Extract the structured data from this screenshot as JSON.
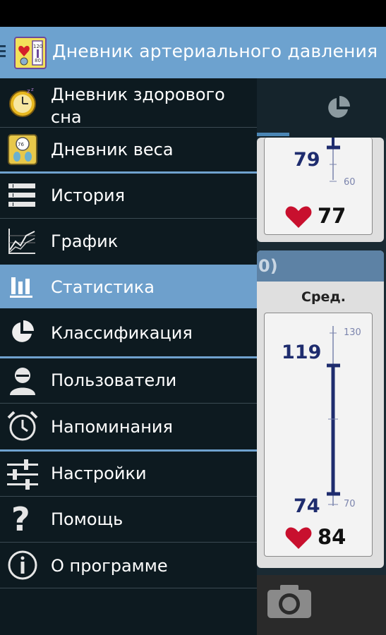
{
  "app": {
    "title": "Дневник артериального давления"
  },
  "drawer": {
    "items": [
      {
        "label_line1": "Дневник здорового",
        "label_line2": "сна",
        "icon": "sleep-clock-icon"
      },
      {
        "label": "Дневник веса",
        "icon": "scale-icon"
      },
      {
        "label": "История",
        "icon": "list-icon"
      },
      {
        "label": "График",
        "icon": "line-chart-icon"
      },
      {
        "label": "Статистика",
        "icon": "bar-chart-icon",
        "selected": true
      },
      {
        "label": "Классификация",
        "icon": "pie-chart-icon"
      },
      {
        "label": "Пользователи",
        "icon": "user-icon"
      },
      {
        "label": "Напоминания",
        "icon": "alarm-clock-icon"
      },
      {
        "label": "Настройки",
        "icon": "sliders-icon"
      },
      {
        "label": "Помощь",
        "icon": "question-icon"
      },
      {
        "label": "О программе",
        "icon": "info-icon"
      }
    ]
  },
  "background": {
    "card1": {
      "systolic": "79",
      "tick_low": "60",
      "pulse": "77"
    },
    "card2": {
      "header_fragment": "0)",
      "column_label": "Сред.",
      "systolic": "119",
      "diastolic": "74",
      "tick_high": "130",
      "tick_low": "70",
      "pulse": "84"
    }
  },
  "colors": {
    "action_bar": "#6da2cf",
    "drawer_bg": "#0d1a20",
    "selected": "#6ea0cc",
    "heart": "#c8102e",
    "gauge": "#1e2c6e"
  }
}
